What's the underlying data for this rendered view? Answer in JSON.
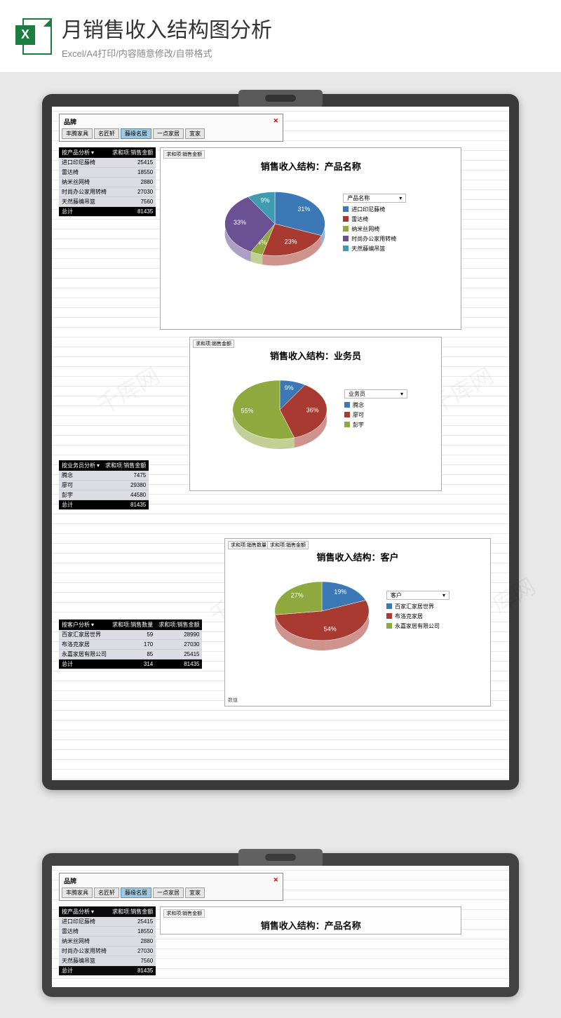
{
  "header": {
    "title": "月销售收入结构图分析",
    "subtitle": "Excel/A4打印/内容随意修改/自带格式",
    "x": "X"
  },
  "slicer": {
    "title": "品牌",
    "clear": "✕",
    "buttons": [
      "丰腾家具",
      "名匠轩",
      "藤缘名居",
      "一点家居",
      "宜家"
    ],
    "active": 2
  },
  "watermark": "千库网",
  "pivotProduct": {
    "h1": "按产品分析",
    "h2": "求和项:销售金额",
    "rows": [
      [
        "进口印尼藤椅",
        "25415"
      ],
      [
        "雷达椅",
        "18550"
      ],
      [
        "纳米丝网椅",
        "2880"
      ],
      [
        "时尚办公家用转椅",
        "27030"
      ],
      [
        "天然藤编吊篮",
        "7560"
      ]
    ],
    "total": [
      "总计",
      "81435"
    ]
  },
  "pivotSales": {
    "h1": "按业务员分析",
    "h2": "求和项:销售金额",
    "rows": [
      [
        "腾念",
        "7475"
      ],
      [
        "廖可",
        "29380"
      ],
      [
        "彭宇",
        "44580"
      ]
    ],
    "total": [
      "总计",
      "81435"
    ]
  },
  "pivotCust": {
    "h1": "按客户分析",
    "h2": "求和项:销售数量",
    "h3": "求和项:销售金额",
    "rows": [
      [
        "百家汇家居世界",
        "59",
        "28990"
      ],
      [
        "布洛克家居",
        "170",
        "27030"
      ],
      [
        "永嘉家居有限公司",
        "85",
        "25415"
      ]
    ],
    "total": [
      "总计",
      "314",
      "81435"
    ]
  },
  "chart_data": [
    {
      "type": "pie",
      "title": "销售收入结构：产品名称",
      "boxlabel": "求和项:销售金额",
      "legend_title": "产品名称",
      "series": [
        {
          "name": "进口印尼藤椅",
          "value": 31,
          "color": "#3b78b5"
        },
        {
          "name": "雷达椅",
          "value": 23,
          "color": "#a83a32"
        },
        {
          "name": "纳米丝网椅",
          "value": 4,
          "color": "#8fa93f"
        },
        {
          "name": "时尚办公家用转椅",
          "value": 33,
          "color": "#6a5193"
        },
        {
          "name": "天然藤编吊篮",
          "value": 9,
          "color": "#3f9bb0"
        }
      ]
    },
    {
      "type": "pie",
      "title": "销售收入结构：业务员",
      "boxlabel": "求和项:销售金额",
      "legend_title": "业务员",
      "series": [
        {
          "name": "腾念",
          "value": 9,
          "color": "#3b78b5"
        },
        {
          "name": "廖可",
          "value": 36,
          "color": "#a83a32"
        },
        {
          "name": "彭宇",
          "value": 55,
          "color": "#8fa93f"
        }
      ]
    },
    {
      "type": "pie",
      "title": "销售收入结构：客户",
      "boxlabel": "求和项:销售数量",
      "boxlabel2": "求和项:销售金额",
      "legend_title": "客户",
      "axis": "数值",
      "series": [
        {
          "name": "百家汇家居世界",
          "value": 19,
          "color": "#3b78b5"
        },
        {
          "name": "布洛克家居",
          "value": 54,
          "color": "#a83a32"
        },
        {
          "name": "永嘉家居有限公司",
          "value": 27,
          "color": "#8fa93f"
        }
      ]
    }
  ]
}
